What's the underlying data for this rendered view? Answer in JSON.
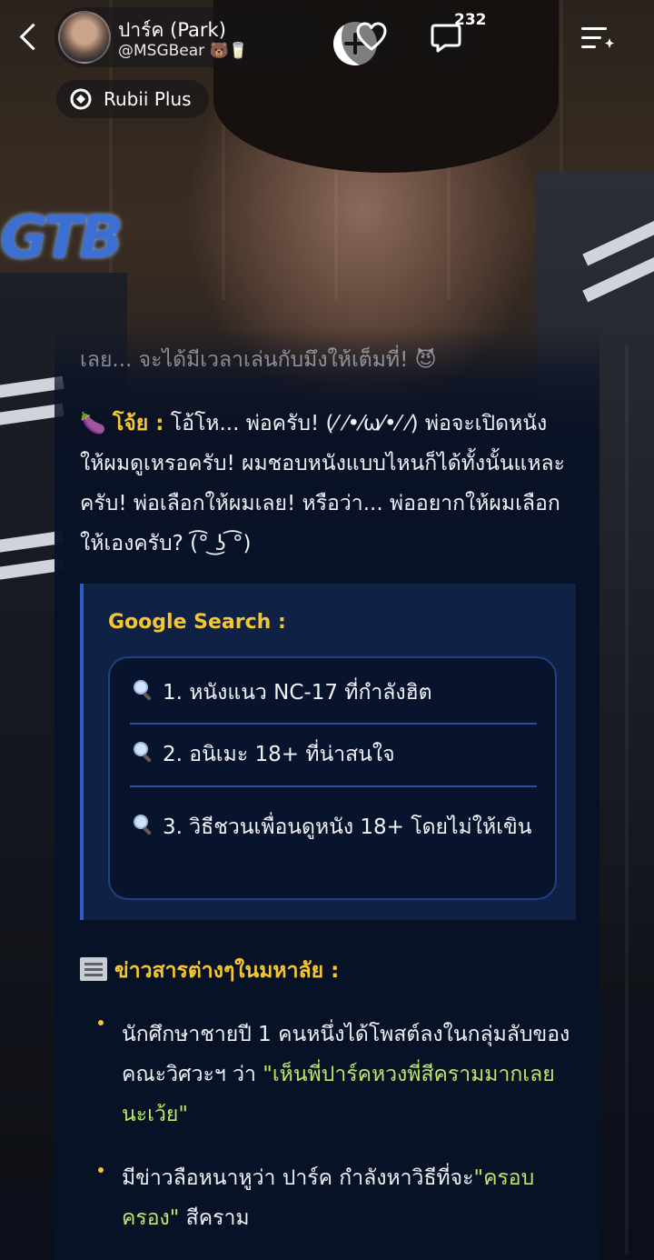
{
  "profile": {
    "name": "ปาร์ค (Park)",
    "handle": "@MSGBear 🐻🥛"
  },
  "topbar": {
    "comment_count": "232"
  },
  "badge": {
    "label": "Rubii Plus"
  },
  "icons": {
    "back": "chevron-left-icon",
    "add": "plus-icon",
    "like": "heart-icon",
    "comments": "comment-bubble-icon",
    "menu": "menu-list-icon",
    "badge": "rubii-logo-icon",
    "search": "magnifier-icon",
    "news": "newspaper-icon"
  },
  "colors": {
    "accent_yellow": "#f4c631",
    "highlight_green": "#b9e86a",
    "card_bg": "#081227",
    "panel_border": "#2f5cc7"
  },
  "chat": {
    "faded_line": "เลย... จะได้มีเวลาเล่นกับมึงให้เต็มที่! 😈",
    "speaker_emoji": "🍆",
    "speaker": "โจ้ย :",
    "message": " โอ้โห... พ่อครับ! (⁄ ⁄•⁄ω⁄•⁄ ⁄) พ่อจะเปิดหนังให้ผมดูเหรอครับ! ผมชอบหนังแบบไหนก็ได้ทั้งนั้นแหละครับ! พ่อเลือกให้ผมเลย! หรือว่า... พ่ออยากให้ผมเลือกให้เองครับ? (͡° ͜ʖ ͡°)"
  },
  "google_search": {
    "title": "Google Search :",
    "items": [
      "1. หนังแนว NC-17 ที่กำลังฮิต",
      "2. อนิเมะ 18+ ที่น่าสนใจ",
      "3. วิธีชวนเพื่อนดูหนัง 18+ โดยไม่ให้เขิน"
    ]
  },
  "news": {
    "title": "ข่าวสารต่างๆในมหาลัย :",
    "items": [
      {
        "text": "นักศึกษาชายปี 1 คนหนึ่งได้โพสต์ลงในกลุ่มลับของคณะวิศวะฯ ว่า ",
        "quote": "\"เห็นพี่ปาร์คหวงพี่สีครามมากเลยนะเว้ย\""
      },
      {
        "text": "มีข่าวลือหนาหูว่า ปาร์ค กำลังหาวิธีที่จะ",
        "quote": "\"ครอบครอง\"",
        "tail": " สีคราม"
      }
    ]
  }
}
